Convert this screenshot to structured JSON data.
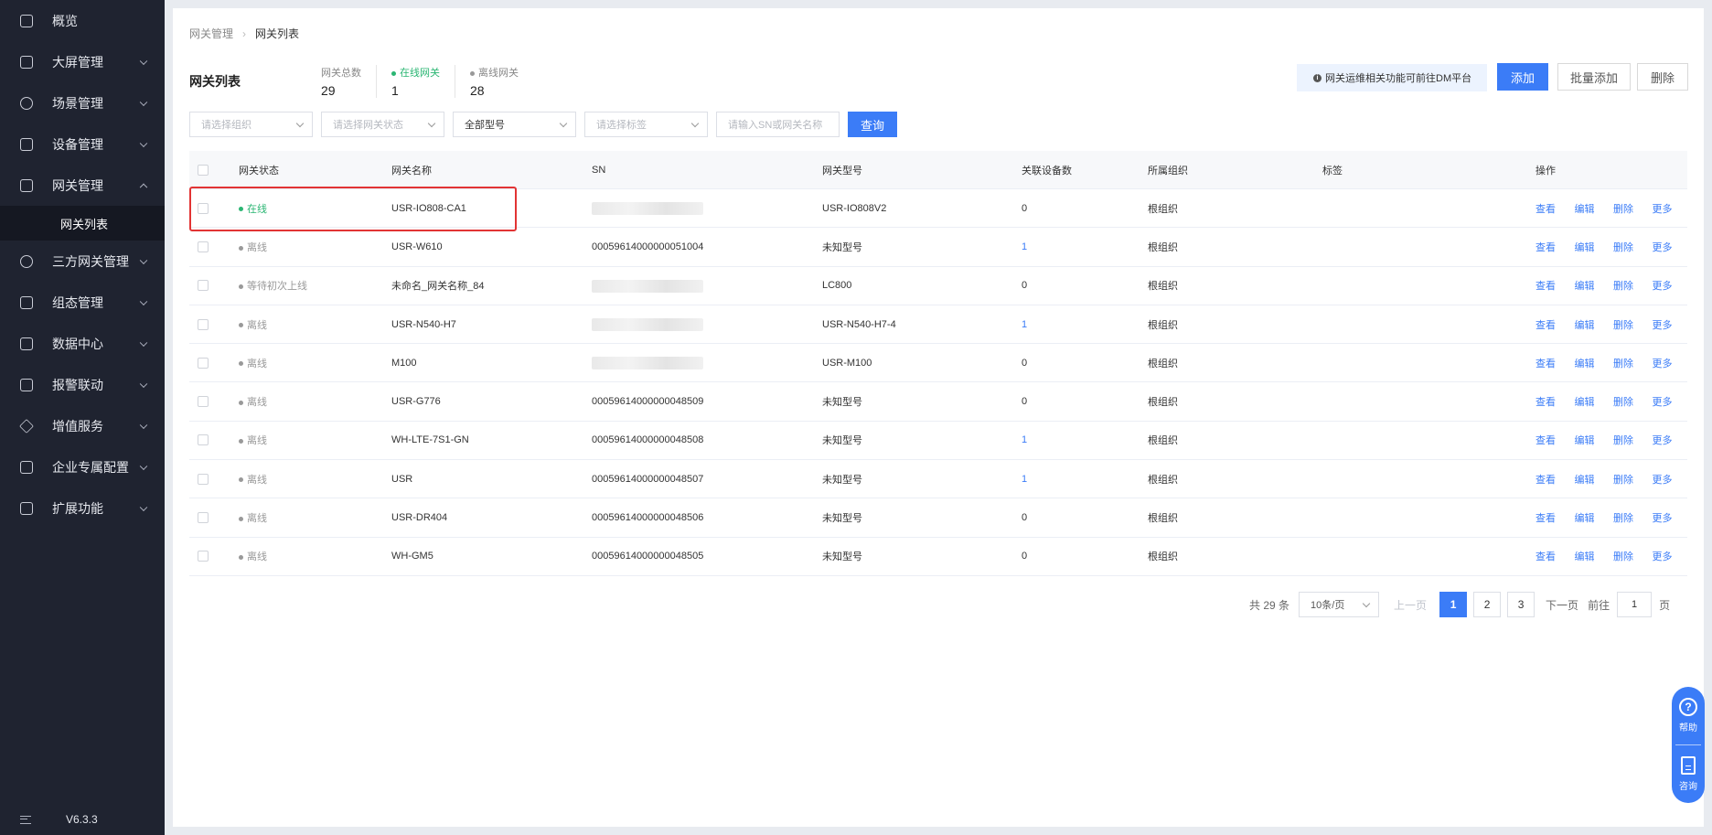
{
  "sidebar": {
    "items": [
      {
        "label": "概览",
        "icon": "overview-icon",
        "expanded": false,
        "has_arrow": false
      },
      {
        "label": "大屏管理",
        "icon": "screen-icon",
        "has_arrow": true
      },
      {
        "label": "场景管理",
        "icon": "scene-icon",
        "has_arrow": true
      },
      {
        "label": "设备管理",
        "icon": "device-icon",
        "has_arrow": true
      },
      {
        "label": "网关管理",
        "icon": "gateway-icon",
        "has_arrow": true,
        "expanded": true
      },
      {
        "label": "三方网关管理",
        "icon": "third-party-gateway-icon",
        "has_arrow": true
      },
      {
        "label": "组态管理",
        "icon": "configuration-icon",
        "has_arrow": true
      },
      {
        "label": "数据中心",
        "icon": "data-center-icon",
        "has_arrow": true
      },
      {
        "label": "报警联动",
        "icon": "alarm-icon",
        "has_arrow": true
      },
      {
        "label": "增值服务",
        "icon": "value-added-icon",
        "has_arrow": true
      },
      {
        "label": "企业专属配置",
        "icon": "enterprise-icon",
        "has_arrow": true
      },
      {
        "label": "扩展功能",
        "icon": "extension-icon",
        "has_arrow": true
      }
    ],
    "sub_item": "网关列表",
    "version": "V6.3.3"
  },
  "breadcrumb": {
    "parent": "网关管理",
    "current": "网关列表"
  },
  "page_title": "网关列表",
  "stats": {
    "total_label": "网关总数",
    "total_value": "29",
    "online_label": "在线网关",
    "online_value": "1",
    "offline_label": "离线网关",
    "offline_value": "28"
  },
  "notice": "网关运维相关功能可前往DM平台",
  "buttons": {
    "add": "添加",
    "batch_add": "批量添加",
    "delete": "删除"
  },
  "filters": {
    "org_placeholder": "请选择组织",
    "status_placeholder": "请选择网关状态",
    "model_value": "全部型号",
    "tag_placeholder": "请选择标签",
    "search_placeholder": "请输入SN或网关名称",
    "query": "查询"
  },
  "table": {
    "headers": {
      "status": "网关状态",
      "name": "网关名称",
      "sn": "SN",
      "model": "网关型号",
      "devices": "关联设备数",
      "org": "所属组织",
      "tag": "标签",
      "actions": "操作"
    },
    "action_labels": {
      "view": "查看",
      "edit": "编辑",
      "delete": "删除",
      "more": "更多"
    },
    "rows": [
      {
        "status": "在线",
        "online": true,
        "name": "USR-IO808-CA1",
        "sn": "",
        "sn_blurred": true,
        "model": "USR-IO808V2",
        "devices": "0",
        "devices_link": false,
        "org": "根组织"
      },
      {
        "status": "离线",
        "online": false,
        "name": "USR-W610",
        "sn": "00059614000000051004",
        "sn_blurred": false,
        "model": "未知型号",
        "devices": "1",
        "devices_link": true,
        "org": "根组织"
      },
      {
        "status": "等待初次上线",
        "online": false,
        "name": "未命名_网关名称_84",
        "sn": "",
        "sn_blurred": true,
        "model": "LC800",
        "devices": "0",
        "devices_link": false,
        "org": "根组织"
      },
      {
        "status": "离线",
        "online": false,
        "name": "USR-N540-H7",
        "sn": "",
        "sn_blurred": true,
        "model": "USR-N540-H7-4",
        "devices": "1",
        "devices_link": true,
        "org": "根组织"
      },
      {
        "status": "离线",
        "online": false,
        "name": "M100",
        "sn": "",
        "sn_blurred": true,
        "model": "USR-M100",
        "devices": "0",
        "devices_link": false,
        "org": "根组织"
      },
      {
        "status": "离线",
        "online": false,
        "name": "USR-G776",
        "sn": "00059614000000048509",
        "sn_blurred": false,
        "model": "未知型号",
        "devices": "0",
        "devices_link": false,
        "org": "根组织"
      },
      {
        "status": "离线",
        "online": false,
        "name": "WH-LTE-7S1-GN",
        "sn": "00059614000000048508",
        "sn_blurred": false,
        "model": "未知型号",
        "devices": "1",
        "devices_link": true,
        "org": "根组织"
      },
      {
        "status": "离线",
        "online": false,
        "name": "USR",
        "sn": "00059614000000048507",
        "sn_blurred": false,
        "model": "未知型号",
        "devices": "1",
        "devices_link": true,
        "org": "根组织"
      },
      {
        "status": "离线",
        "online": false,
        "name": "USR-DR404",
        "sn": "00059614000000048506",
        "sn_blurred": false,
        "model": "未知型号",
        "devices": "0",
        "devices_link": false,
        "org": "根组织"
      },
      {
        "status": "离线",
        "online": false,
        "name": "WH-GM5",
        "sn": "00059614000000048505",
        "sn_blurred": false,
        "model": "未知型号",
        "devices": "0",
        "devices_link": false,
        "org": "根组织"
      }
    ]
  },
  "pagination": {
    "total_text": "共 29 条",
    "page_size": "10条/页",
    "prev": "上一页",
    "pages": [
      "1",
      "2",
      "3"
    ],
    "current": "1",
    "next": "下一页",
    "goto_prefix": "前往",
    "goto_value": "1",
    "goto_suffix": "页"
  },
  "float": {
    "help": "帮助",
    "consult": "咨询"
  },
  "colors": {
    "primary": "#3b7cf7",
    "online": "#2bb673",
    "sidebar_bg": "#1f2330",
    "highlight": "#e23434"
  }
}
